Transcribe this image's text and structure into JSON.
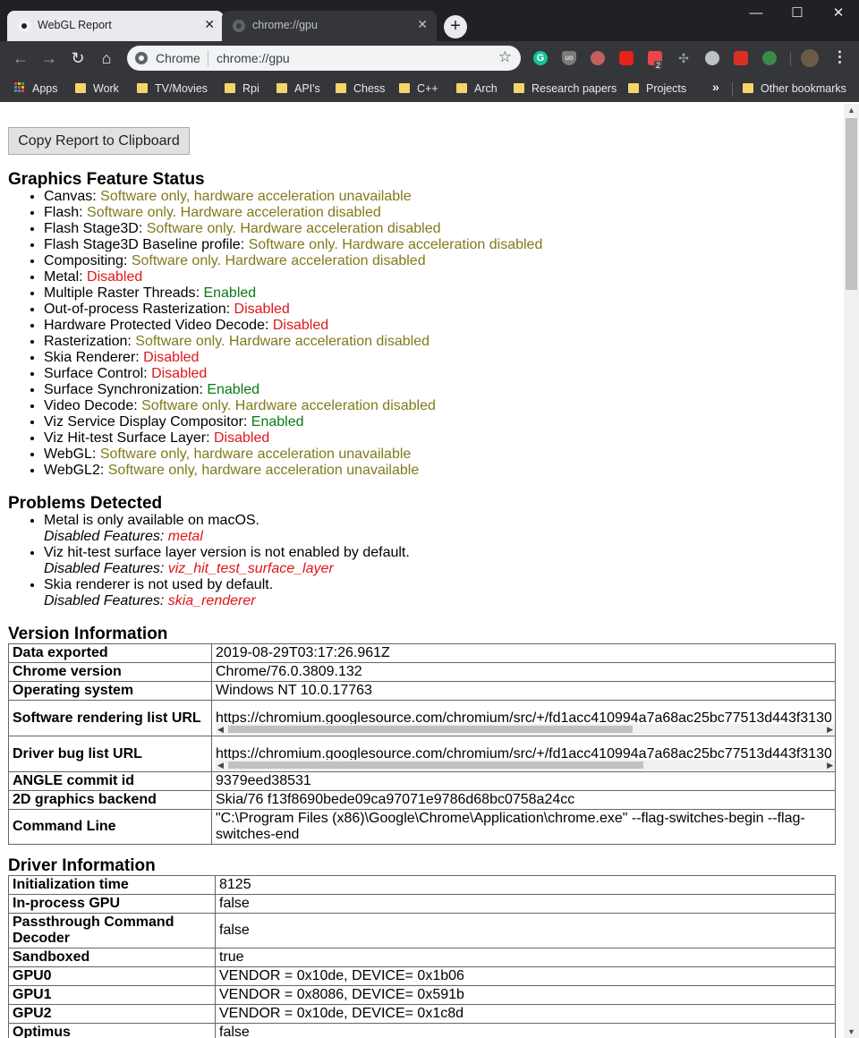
{
  "window": {
    "tabs": [
      {
        "title": "WebGL Report",
        "active": true
      },
      {
        "title": "chrome://gpu",
        "active": false
      }
    ],
    "new_tab_label": "+",
    "controls": {
      "minimize": "—",
      "maximize": "☐",
      "close": "✕"
    }
  },
  "toolbar": {
    "omnibox_chip": "Chrome",
    "omnibox_url": "chrome://gpu",
    "extension_badge": "2",
    "extensions": [
      "grammarly-icon",
      "ublock-icon",
      "play-icon",
      "youtube-icon",
      "dots-icon",
      "cross-icon",
      "check-icon",
      "pin-icon",
      "gear-icon"
    ]
  },
  "bookmarks": {
    "items": [
      "Apps",
      "Work",
      "TV/Movies",
      "Rpi",
      "API's",
      "Chess",
      "C++",
      "Arch",
      "Research papers",
      "Projects"
    ],
    "overflow": "»",
    "other": "Other bookmarks"
  },
  "page": {
    "copy_button": "Copy Report to Clipboard",
    "feature_status": {
      "title": "Graphics Feature Status",
      "items": [
        {
          "name": "Canvas",
          "status": "Software only, hardware acceleration unavailable",
          "color": "#807a1a"
        },
        {
          "name": "Flash",
          "status": "Software only. Hardware acceleration disabled",
          "color": "#807a1a"
        },
        {
          "name": "Flash Stage3D",
          "status": "Software only. Hardware acceleration disabled",
          "color": "#807a1a"
        },
        {
          "name": "Flash Stage3D Baseline profile",
          "status": "Software only. Hardware acceleration disabled",
          "color": "#807a1a"
        },
        {
          "name": "Compositing",
          "status": "Software only. Hardware acceleration disabled",
          "color": "#807a1a"
        },
        {
          "name": "Metal",
          "status": "Disabled",
          "color": "#e0161b"
        },
        {
          "name": "Multiple Raster Threads",
          "status": "Enabled",
          "color": "#0a7a14"
        },
        {
          "name": "Out-of-process Rasterization",
          "status": "Disabled",
          "color": "#e0161b"
        },
        {
          "name": "Hardware Protected Video Decode",
          "status": "Disabled",
          "color": "#e0161b"
        },
        {
          "name": "Rasterization",
          "status": "Software only. Hardware acceleration disabled",
          "color": "#807a1a"
        },
        {
          "name": "Skia Renderer",
          "status": "Disabled",
          "color": "#e0161b"
        },
        {
          "name": "Surface Control",
          "status": "Disabled",
          "color": "#e0161b"
        },
        {
          "name": "Surface Synchronization",
          "status": "Enabled",
          "color": "#0a7a14"
        },
        {
          "name": "Video Decode",
          "status": "Software only. Hardware acceleration disabled",
          "color": "#807a1a"
        },
        {
          "name": "Viz Service Display Compositor",
          "status": "Enabled",
          "color": "#0a7a14"
        },
        {
          "name": "Viz Hit-test Surface Layer",
          "status": "Disabled",
          "color": "#e0161b"
        },
        {
          "name": "WebGL",
          "status": "Software only, hardware acceleration unavailable",
          "color": "#807a1a"
        },
        {
          "name": "WebGL2",
          "status": "Software only, hardware acceleration unavailable",
          "color": "#807a1a"
        }
      ]
    },
    "problems": {
      "title": "Problems Detected",
      "disabled_label": "Disabled Features:",
      "items": [
        {
          "text": "Metal is only available on macOS.",
          "feature": "metal"
        },
        {
          "text": "Viz hit-test surface layer version is not enabled by default.",
          "feature": "viz_hit_test_surface_layer"
        },
        {
          "text": "Skia renderer is not used by default.",
          "feature": "skia_renderer"
        }
      ]
    },
    "version_info": {
      "title": "Version Information",
      "data_exported_label": "Data exported",
      "data_exported": "2019-08-29T03:17:26.961Z",
      "chrome_version_label": "Chrome version",
      "chrome_version": "Chrome/76.0.3809.132",
      "os_label": "Operating system",
      "os": "Windows NT 10.0.17763",
      "sw_list_label": "Software rendering list URL",
      "sw_list_url": "https://chromium.googlesource.com/chromium/src/+/fd1acc410994a7a68ac25bc77513d443f3130",
      "driver_bug_label": "Driver bug list URL",
      "driver_bug_url": "https://chromium.googlesource.com/chromium/src/+/fd1acc410994a7a68ac25bc77513d443f3130",
      "angle_label": "ANGLE commit id",
      "angle": "9379eed38531",
      "backend_label": "2D graphics backend",
      "backend": "Skia/76 f13f8690bede09ca97071e9786d68bc0758a24cc",
      "cmdline_label": "Command Line",
      "cmdline": "\"C:\\Program Files (x86)\\Google\\Chrome\\Application\\chrome.exe\" --flag-switches-begin --flag-switches-end"
    },
    "driver_info": {
      "title": "Driver Information",
      "rows": [
        {
          "key": "Initialization time",
          "value": "8125"
        },
        {
          "key": "In-process GPU",
          "value": "false"
        },
        {
          "key": "Passthrough Command Decoder",
          "value": "false"
        },
        {
          "key": "Sandboxed",
          "value": "true"
        },
        {
          "key": "GPU0",
          "value": "VENDOR = 0x10de, DEVICE= 0x1b06"
        },
        {
          "key": "GPU1",
          "value": "VENDOR = 0x8086, DEVICE= 0x591b"
        },
        {
          "key": "GPU2",
          "value": "VENDOR = 0x10de, DEVICE= 0x1c8d"
        },
        {
          "key": "Optimus",
          "value": "false"
        }
      ]
    }
  }
}
